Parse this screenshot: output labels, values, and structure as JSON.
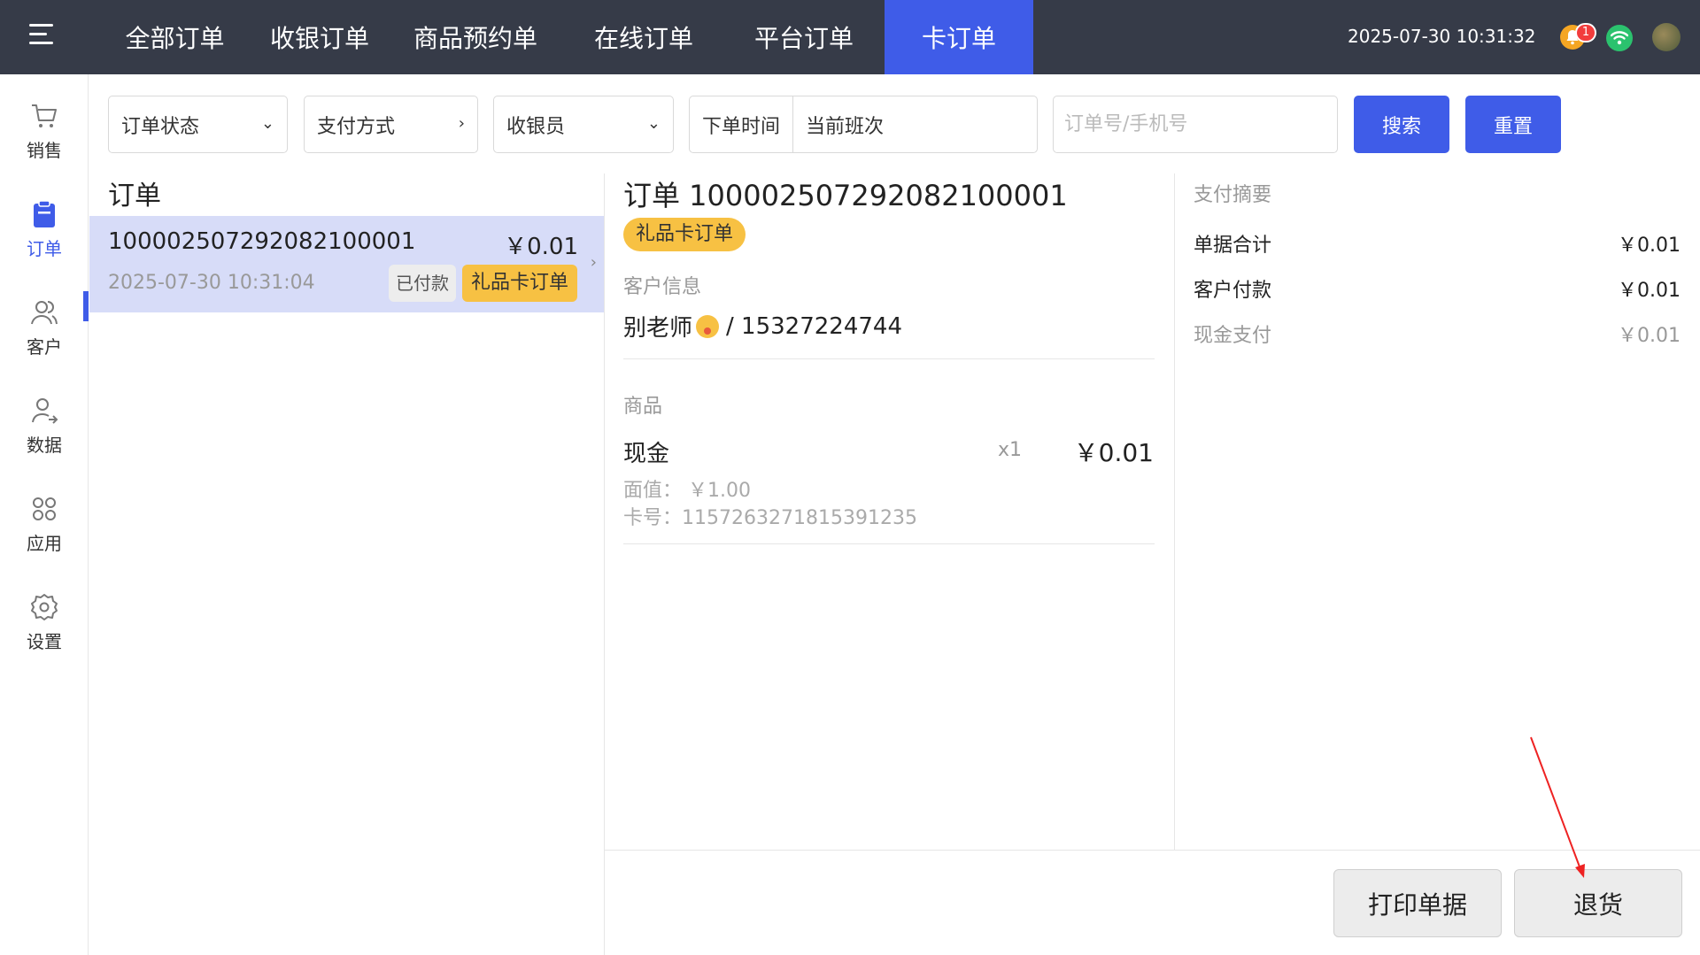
{
  "topbar": {
    "tabs": [
      {
        "label": "全部订单"
      },
      {
        "label": "收银订单"
      },
      {
        "label": "商品预约单"
      },
      {
        "label": "在线订单"
      },
      {
        "label": "平台订单"
      },
      {
        "label": "卡订单"
      }
    ],
    "active_tab": "卡订单",
    "datetime": "2025-07-30 10:31:32",
    "notification_count": "1",
    "accent_color": "#3f5ce8"
  },
  "sidebar": {
    "items": [
      {
        "label": "销售",
        "icon": "cart-icon"
      },
      {
        "label": "订单",
        "icon": "clipboard-icon"
      },
      {
        "label": "客户",
        "icon": "customers-icon"
      },
      {
        "label": "数据",
        "icon": "user-data-icon"
      },
      {
        "label": "应用",
        "icon": "apps-icon"
      },
      {
        "label": "设置",
        "icon": "gear-icon"
      }
    ],
    "active": "订单"
  },
  "filters": {
    "order_status": "订单状态",
    "payment_method": "支付方式",
    "cashier": "收银员",
    "time_label": "下单时间",
    "time_value": "当前班次",
    "search_placeholder": "订单号/手机号",
    "search_button": "搜索",
    "reset_button": "重置"
  },
  "order_list": {
    "title": "订单",
    "orders": [
      {
        "number": "100002507292082100001",
        "amount": "￥0.01",
        "time": "2025-07-30 10:31:04",
        "status": "已付款",
        "tag": "礼品卡订单"
      }
    ]
  },
  "detail": {
    "title": "订单 100002507292082100001",
    "tag": "礼品卡订单",
    "customer_label": "客户信息",
    "customer_name": "别老师",
    "customer_phone": "/ 15327224744",
    "goods_label": "商品",
    "item": {
      "name": "现金",
      "qty": "x1",
      "price": "￥0.01",
      "face_value": "面值：  ￥1.00",
      "card_no": "卡号：1157263271815391235"
    }
  },
  "payment": {
    "title": "支付摘要",
    "rows": [
      {
        "label": "单据合计",
        "value": "￥0.01"
      },
      {
        "label": "客户付款",
        "value": "￥0.01"
      },
      {
        "label": "现金支付",
        "value": "￥0.01"
      }
    ]
  },
  "actions": {
    "print": "打印单据",
    "refund": "退货"
  }
}
